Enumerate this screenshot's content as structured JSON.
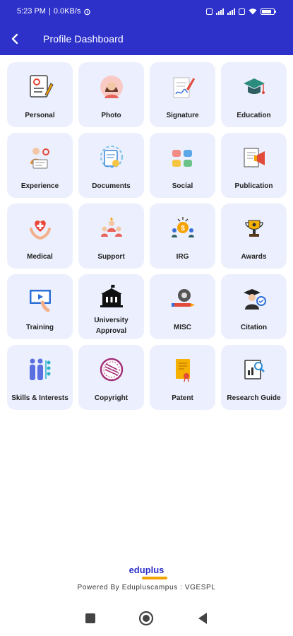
{
  "status": {
    "time": "5:23 PM",
    "speed": "0.0KB/s",
    "battery": "88"
  },
  "header": {
    "title": "Profile Dashboard"
  },
  "tiles": [
    {
      "label": "Personal",
      "icon": "personal-icon"
    },
    {
      "label": "Photo",
      "icon": "photo-icon"
    },
    {
      "label": "Signature",
      "icon": "signature-icon"
    },
    {
      "label": "Education",
      "icon": "education-icon"
    },
    {
      "label": "Experience",
      "icon": "experience-icon"
    },
    {
      "label": "Documents",
      "icon": "documents-icon"
    },
    {
      "label": "Social",
      "icon": "social-icon"
    },
    {
      "label": "Publication",
      "icon": "publication-icon"
    },
    {
      "label": "Medical",
      "icon": "medical-icon"
    },
    {
      "label": "Support",
      "icon": "support-icon"
    },
    {
      "label": "IRG",
      "icon": "irg-icon"
    },
    {
      "label": "Awards",
      "icon": "awards-icon"
    },
    {
      "label": "Training",
      "icon": "training-icon"
    },
    {
      "label": "University Approval",
      "icon": "university-icon"
    },
    {
      "label": "MISC",
      "icon": "misc-icon"
    },
    {
      "label": "Citation",
      "icon": "citation-icon"
    },
    {
      "label": "Skills & Interests",
      "icon": "skills-icon"
    },
    {
      "label": "Copyright",
      "icon": "copyright-icon"
    },
    {
      "label": "Patent",
      "icon": "patent-icon"
    },
    {
      "label": "Research Guide",
      "icon": "research-guide-icon"
    }
  ],
  "footer": {
    "logo_text": "eduplus",
    "powered_by": "Powered By Edupluscampus : VGESPL"
  },
  "colors": {
    "primary": "#2d31c9",
    "tile_bg": "#eceffd",
    "accent": "#f5a300"
  }
}
